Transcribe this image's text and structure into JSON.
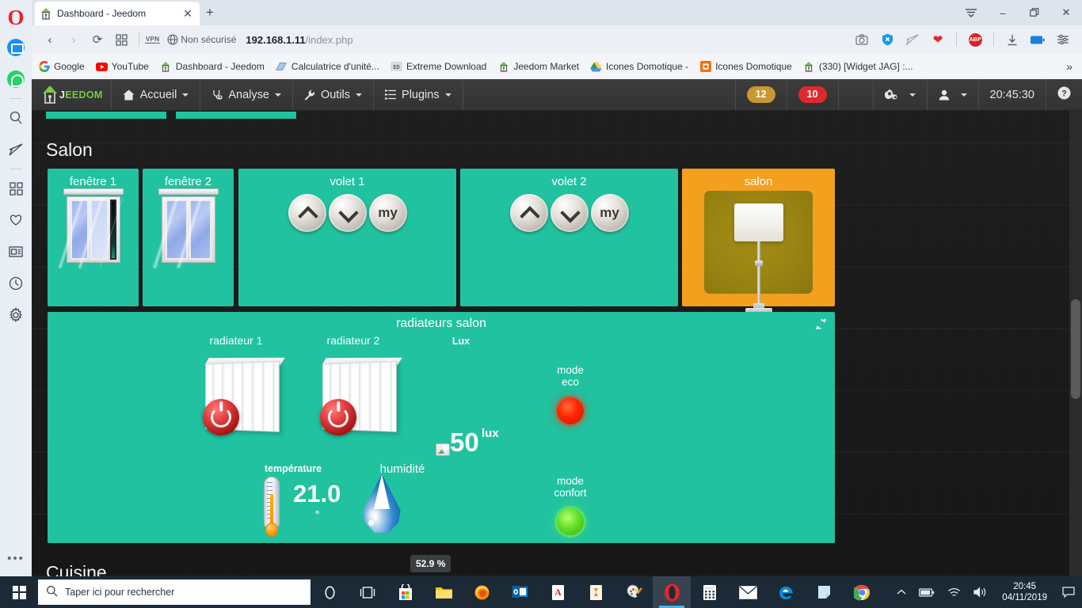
{
  "browser": {
    "tab": {
      "title": "Dashboard - Jeedom",
      "favicon": "jeedom-icon",
      "close": "✕"
    },
    "new_tab": "+",
    "window_controls": {
      "menu": "≡",
      "minimize": "–",
      "maximize": "❐",
      "close": "✕"
    },
    "nav": {
      "back": "‹",
      "forward": "›",
      "reload": "⟳",
      "tiles": "grid-icon",
      "vpn_badge": "VPN",
      "security_label": "Non sécurisé",
      "url_host": "192.168.1.11",
      "url_path": "/index.php",
      "actions": [
        "snapshot-icon",
        "security-shield-icon",
        "send-icon",
        "heart-icon",
        "abp-icon",
        "download-icon",
        "battery-icon",
        "easy-setup-icon"
      ],
      "abp_label": "ABP"
    },
    "bookmarks": [
      {
        "label": "Google",
        "icon": "google-icon"
      },
      {
        "label": "YouTube",
        "icon": "youtube-icon"
      },
      {
        "label": "Dashboard - Jeedom",
        "icon": "jeedom-icon"
      },
      {
        "label": "Calculatrice d'unité...",
        "icon": "calculator-icon"
      },
      {
        "label": "Extreme Download",
        "icon": "extreme-download-icon"
      },
      {
        "label": "Jeedom Market",
        "icon": "jeedom-icon"
      },
      {
        "label": "Icones Domotique -",
        "icon": "google-drive-icon"
      },
      {
        "label": "Icones Domotique",
        "icon": "orange-folder-icon"
      },
      {
        "label": "(330) [Widget JAG] :...",
        "icon": "jeedom-icon"
      }
    ],
    "bookmarks_overflow": "»",
    "sidebar": [
      {
        "name": "messenger-icon"
      },
      {
        "name": "whatsapp-icon"
      },
      {
        "name": "search-icon"
      },
      {
        "name": "send-icon"
      },
      {
        "name": "speed-dial-icon"
      },
      {
        "name": "bookmarks-heart-icon"
      },
      {
        "name": "news-icon"
      },
      {
        "name": "history-clock-icon"
      },
      {
        "name": "settings-gear-icon"
      },
      {
        "name": "more-dots-icon"
      }
    ]
  },
  "jeedom": {
    "logo": {
      "text_a": "J",
      "text_b": "EEDOM"
    },
    "menu": [
      {
        "label": "Accueil",
        "icon": "home-icon"
      },
      {
        "label": "Analyse",
        "icon": "stethoscope-icon"
      },
      {
        "label": "Outils",
        "icon": "wrench-icon"
      },
      {
        "label": "Plugins",
        "icon": "list-icon"
      }
    ],
    "badges": [
      {
        "value": "12",
        "color": "#c99833"
      },
      {
        "value": "10",
        "color": "#e0292f"
      }
    ],
    "right_tools": [
      {
        "name": "gears-icon"
      },
      {
        "name": "user-icon"
      }
    ],
    "clock": "20:45:30",
    "help": "?",
    "accent_teal": "#20c2a0",
    "accent_orange": "#f2a01e"
  },
  "dashboard": {
    "zone_title": "Salon",
    "next_zone_title": "Cuisine",
    "tiles": [
      {
        "name": "fenêtre 1",
        "type": "window",
        "state": "open"
      },
      {
        "name": "fenêtre 2",
        "type": "window",
        "state": "closed"
      },
      {
        "name": "volet 1",
        "type": "shutter",
        "buttons": [
          "up",
          "down",
          "my"
        ],
        "my_label": "my"
      },
      {
        "name": "volet 2",
        "type": "shutter",
        "buttons": [
          "up",
          "down",
          "my"
        ],
        "my_label": "my"
      },
      {
        "name": "salon",
        "type": "lamp",
        "state": "on"
      }
    ],
    "panel": {
      "title": "radiateurs salon",
      "refresh_icon": "sync-icon",
      "radiators": [
        {
          "label": "radiateur 1",
          "power": "off"
        },
        {
          "label": "radiateur 2",
          "power": "off"
        }
      ],
      "lux": {
        "label": "Lux",
        "value": "50",
        "unit": "lux",
        "icon": "broken-image-icon"
      },
      "modes": [
        {
          "line1": "mode",
          "line2": "eco",
          "led": "red"
        },
        {
          "line1": "mode",
          "line2": "confort",
          "led": "green"
        }
      ],
      "temperature": {
        "label": "température",
        "value": "21.0",
        "unit": "°",
        "icon": "thermometer-icon"
      },
      "humidity": {
        "label": "humidité",
        "value": "52.9 %",
        "icon": "water-drop-icon"
      }
    }
  },
  "taskbar": {
    "start": "windows-logo-icon",
    "search_placeholder": "Taper ici pour rechercher",
    "pinned": [
      {
        "name": "cortana-icon"
      },
      {
        "name": "task-view-icon"
      },
      {
        "name": "microsoft-store-icon"
      },
      {
        "name": "file-explorer-icon"
      },
      {
        "name": "firefox-icon"
      },
      {
        "name": "outlook-icon"
      },
      {
        "name": "acrobat-icon"
      },
      {
        "name": "gimp-icon"
      },
      {
        "name": "paint-icon"
      },
      {
        "name": "opera-icon",
        "active": true
      },
      {
        "name": "calculator-icon"
      },
      {
        "name": "mail-icon"
      },
      {
        "name": "edge-icon"
      },
      {
        "name": "sticky-notes-icon"
      },
      {
        "name": "chrome-icon"
      }
    ],
    "tray": [
      "show-hidden-icons",
      "battery-icon",
      "wifi-icon",
      "volume-icon"
    ],
    "clock_time": "20:45",
    "clock_date": "04/11/2019",
    "action_center": "notification-icon"
  }
}
